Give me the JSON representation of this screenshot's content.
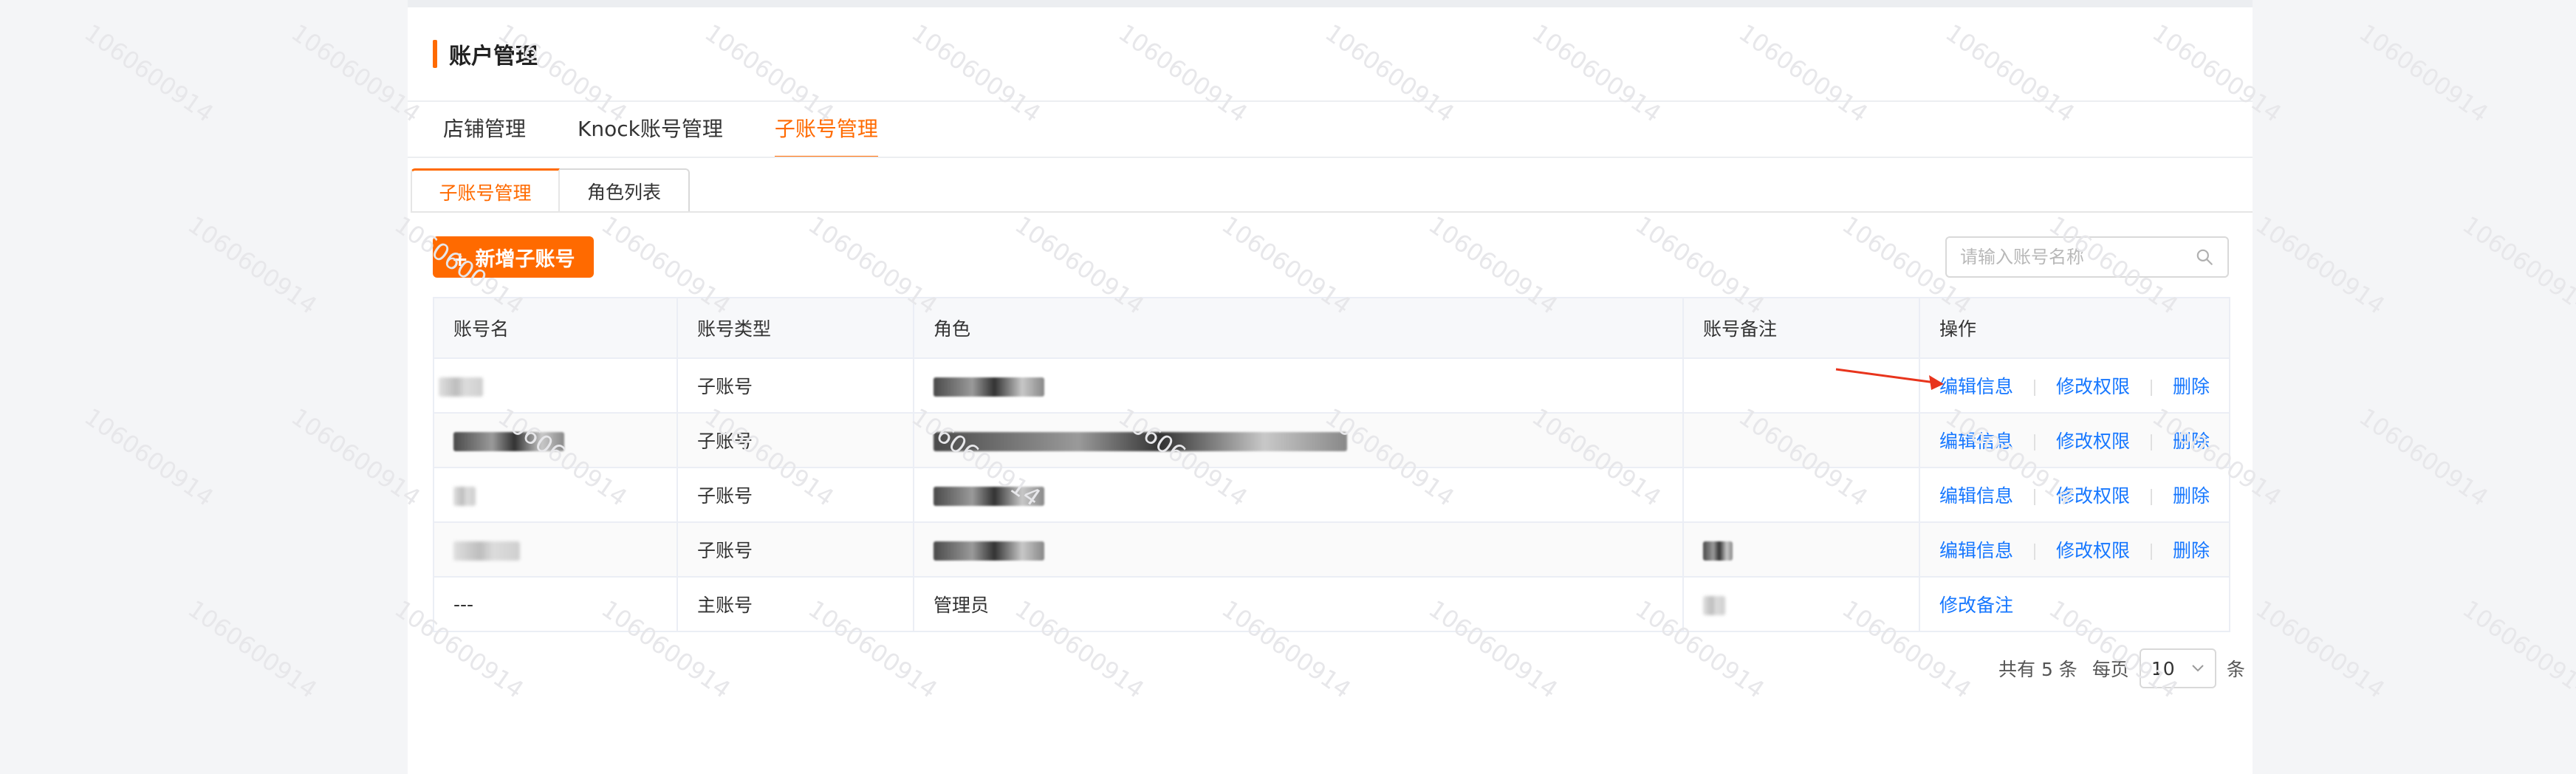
{
  "page": {
    "title": "账户管理"
  },
  "main_tabs": [
    {
      "label": "店铺管理"
    },
    {
      "label": "Knock账号管理"
    },
    {
      "label": "子账号管理"
    }
  ],
  "sub_tabs": [
    {
      "label": "子账号管理"
    },
    {
      "label": "角色列表"
    }
  ],
  "toolbar": {
    "add_button": "+ 新增子账号"
  },
  "search": {
    "placeholder": "请输入账号名称"
  },
  "table": {
    "columns": [
      "账号名",
      "账号类型",
      "角色",
      "账号备注",
      "操作"
    ],
    "rows": [
      {
        "name": "",
        "type": "子账号",
        "role": "",
        "remark": "",
        "actions": [
          "编辑信息",
          "修改权限",
          "删除"
        ]
      },
      {
        "name": "",
        "type": "子账号",
        "role": "",
        "remark": "",
        "actions": [
          "编辑信息",
          "修改权限",
          "删除"
        ]
      },
      {
        "name": "",
        "type": "子账号",
        "role": "",
        "remark": "",
        "actions": [
          "编辑信息",
          "修改权限",
          "删除"
        ]
      },
      {
        "name": "",
        "type": "子账号",
        "role": "",
        "remark": "",
        "actions": [
          "编辑信息",
          "修改权限",
          "删除"
        ]
      },
      {
        "name": "---",
        "type": "主账号",
        "role": "管理员",
        "remark": "",
        "actions": [
          "修改备注"
        ]
      }
    ]
  },
  "pagination": {
    "total_label": "共有 5 条",
    "per_page_label": "每页",
    "page_size": "10",
    "suffix": "条"
  },
  "watermark": "1060600914",
  "colors": {
    "accent": "#ff6a00",
    "link": "#1677ff",
    "annotation_arrow": "#e8341c"
  }
}
